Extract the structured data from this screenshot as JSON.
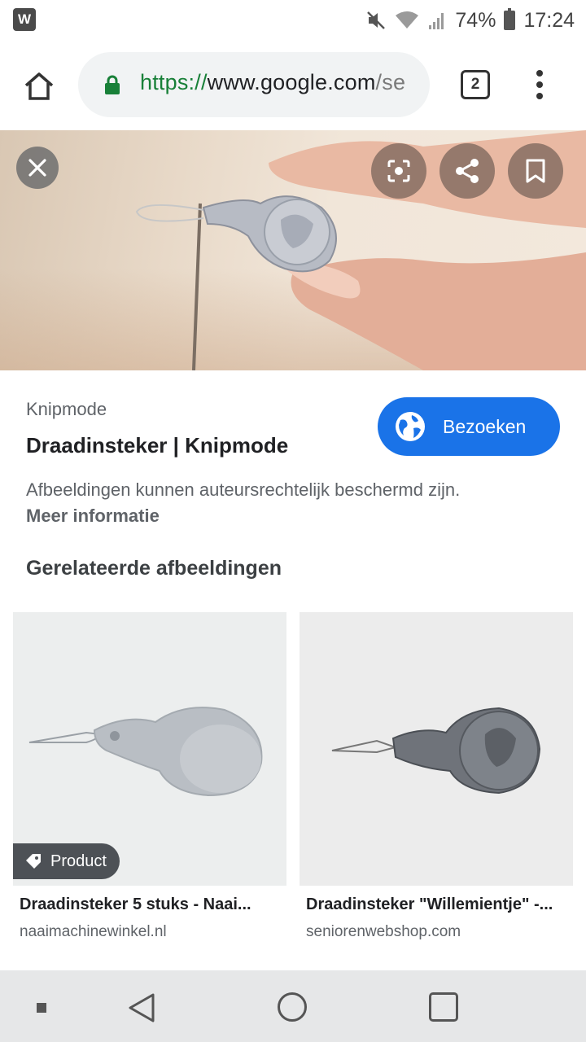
{
  "status_bar": {
    "app_badge": "W",
    "battery_percent": "74%",
    "time": "17:24"
  },
  "toolbar": {
    "url_scheme": "https://",
    "url_host": "www.google.com",
    "url_rest": "/se",
    "tab_count": "2"
  },
  "result": {
    "source": "Knipmode",
    "title": "Draadinsteker | Knipmode",
    "visit_label": "Bezoeken",
    "notice": "Afbeeldingen kunnen auteursrechtelijk beschermd zijn.",
    "more_info": "Meer informatie"
  },
  "related": {
    "heading": "Gerelateerde afbeeldingen",
    "items": [
      {
        "title": "Draadinsteker 5 stuks - Naai...",
        "domain": "naaimachinewinkel.nl",
        "badge": "Product"
      },
      {
        "title": "Draadinsteker \"Willemientje\" -...",
        "domain": "seniorenwebshop.com"
      }
    ]
  },
  "colors": {
    "accent": "#1a73e8",
    "secure": "#188038"
  }
}
